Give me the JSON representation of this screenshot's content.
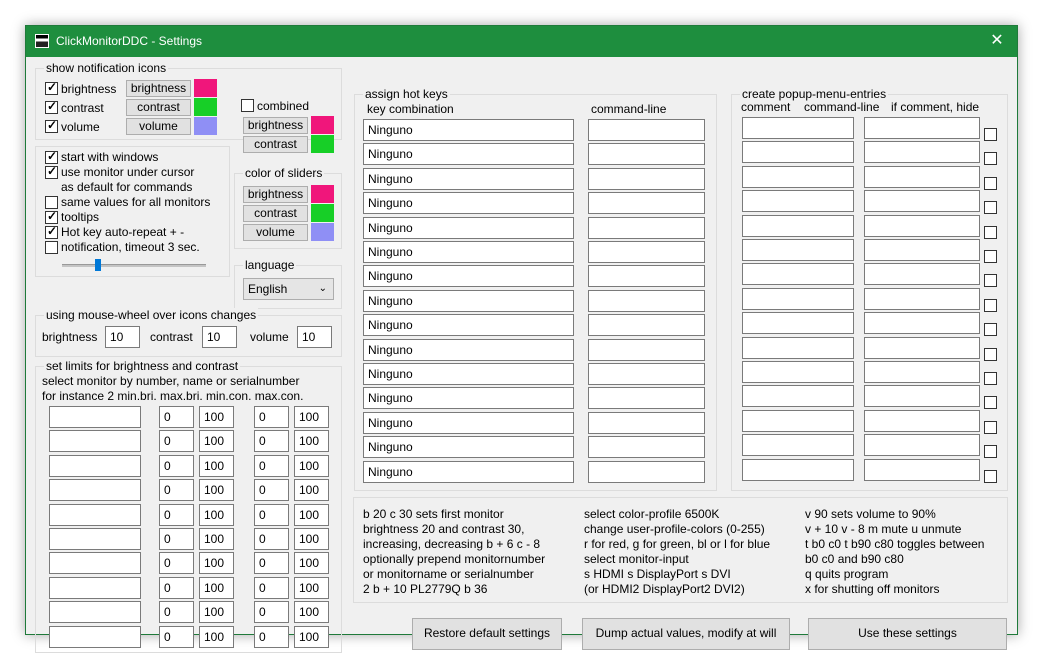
{
  "window": {
    "title": "ClickMonitorDDC - Settings",
    "close": "✕"
  },
  "notification": {
    "title": "show notification icons",
    "items": [
      {
        "label": "brightness",
        "checked": true,
        "button": "brightness",
        "color": "#f0167b"
      },
      {
        "label": "contrast",
        "checked": true,
        "button": "contrast",
        "color": "#17cf27"
      },
      {
        "label": "volume",
        "checked": true,
        "button": "volume",
        "color": "#8f8ff5"
      }
    ],
    "combined": {
      "label": "combined",
      "checked": false,
      "buttons": [
        {
          "label": "brightness",
          "color": "#f0167b"
        },
        {
          "label": "contrast",
          "color": "#17cf27"
        }
      ]
    }
  },
  "options": [
    {
      "label": "start with windows",
      "checked": true
    },
    {
      "label": "use monitor under cursor",
      "label2": "as default for commands",
      "checked": true
    },
    {
      "label": "same values for all monitors",
      "checked": false
    },
    {
      "label": "tooltips",
      "checked": true
    },
    {
      "label": "Hot key auto-repeat  +  -",
      "checked": true
    },
    {
      "label": "notification, timeout 3 sec.",
      "checked": false
    }
  ],
  "slider": {
    "value_fraction": 0.25
  },
  "sliders_color": {
    "title": "color of sliders",
    "items": [
      {
        "label": "brightness",
        "color": "#f0167b"
      },
      {
        "label": "contrast",
        "color": "#17cf27"
      },
      {
        "label": "volume",
        "color": "#8f8ff5"
      }
    ]
  },
  "language": {
    "title": "language",
    "value": "English"
  },
  "wheel": {
    "title": "using mouse-wheel over icons changes",
    "items": [
      {
        "label": "brightness",
        "value": "10"
      },
      {
        "label": "contrast",
        "value": "10"
      },
      {
        "label": "volume",
        "value": "10"
      }
    ]
  },
  "limits": {
    "title": "set limits for brightness and contrast",
    "line1": "select monitor by number, name or serialnumber",
    "line2": "for instance  2  min.bri. max.bri.  min.con. max.con.",
    "rows": [
      [
        "",
        "0",
        "100",
        "0",
        "100"
      ],
      [
        "",
        "0",
        "100",
        "0",
        "100"
      ],
      [
        "",
        "0",
        "100",
        "0",
        "100"
      ],
      [
        "",
        "0",
        "100",
        "0",
        "100"
      ],
      [
        "",
        "0",
        "100",
        "0",
        "100"
      ],
      [
        "",
        "0",
        "100",
        "0",
        "100"
      ],
      [
        "",
        "0",
        "100",
        "0",
        "100"
      ],
      [
        "",
        "0",
        "100",
        "0",
        "100"
      ],
      [
        "",
        "0",
        "100",
        "0",
        "100"
      ],
      [
        "",
        "0",
        "100",
        "0",
        "100"
      ]
    ]
  },
  "hotkeys": {
    "title": "assign hot keys",
    "col1": "key combination",
    "col2": "command-line",
    "rows": [
      {
        "key": "Ninguno",
        "cmd": ""
      },
      {
        "key": "Ninguno",
        "cmd": ""
      },
      {
        "key": "Ninguno",
        "cmd": ""
      },
      {
        "key": "Ninguno",
        "cmd": ""
      },
      {
        "key": "Ninguno",
        "cmd": ""
      },
      {
        "key": "Ninguno",
        "cmd": ""
      },
      {
        "key": "Ninguno",
        "cmd": ""
      },
      {
        "key": "Ninguno",
        "cmd": ""
      },
      {
        "key": "Ninguno",
        "cmd": ""
      },
      {
        "key": "Ninguno",
        "cmd": ""
      },
      {
        "key": "Ninguno",
        "cmd": ""
      },
      {
        "key": "Ninguno",
        "cmd": ""
      },
      {
        "key": "Ninguno",
        "cmd": ""
      },
      {
        "key": "Ninguno",
        "cmd": ""
      },
      {
        "key": "Ninguno",
        "cmd": ""
      }
    ]
  },
  "popup": {
    "title": "create popup-menu-entries",
    "col1": "comment",
    "col2": "command-line",
    "col3": "if comment, hide",
    "rows": [
      {
        "comment": "",
        "cmd": "",
        "hide": false
      },
      {
        "comment": "",
        "cmd": "",
        "hide": false
      },
      {
        "comment": "",
        "cmd": "",
        "hide": false
      },
      {
        "comment": "",
        "cmd": "",
        "hide": false
      },
      {
        "comment": "",
        "cmd": "",
        "hide": false
      },
      {
        "comment": "",
        "cmd": "",
        "hide": false
      },
      {
        "comment": "",
        "cmd": "",
        "hide": false
      },
      {
        "comment": "",
        "cmd": "",
        "hide": false
      },
      {
        "comment": "",
        "cmd": "",
        "hide": false
      },
      {
        "comment": "",
        "cmd": "",
        "hide": false
      },
      {
        "comment": "",
        "cmd": "",
        "hide": false
      },
      {
        "comment": "",
        "cmd": "",
        "hide": false
      },
      {
        "comment": "",
        "cmd": "",
        "hide": false
      },
      {
        "comment": "",
        "cmd": "",
        "hide": false
      },
      {
        "comment": "",
        "cmd": "",
        "hide": false
      }
    ]
  },
  "help": {
    "col1": [
      "b 20  c 30  sets first monitor",
      "brightness 20 and contrast 30,",
      "increasing, decreasing  b + 6   c - 8",
      "optionally prepend monitornumber",
      "or monitorname or serialnumber",
      "2  b + 10          PL2779Q   b 36"
    ],
    "col2": [
      "select color-profile  6500K",
      "change user-profile-colors (0-255)",
      "r for red, g for green, bl or l for blue",
      "select monitor-input",
      "s  HDMI    s  DisplayPort    s  DVI",
      "(or HDMI2  DisplayPort2  DVI2)"
    ],
    "col3": [
      "v 90 sets volume to 90%",
      "v + 10   v  - 8   m mute  u unmute",
      "t b0 c0 t b90 c80 toggles between",
      "b0 c0 and b90 c80",
      "q  quits program",
      "x for shutting off monitors"
    ]
  },
  "buttons": {
    "restore": "Restore default settings",
    "dump": "Dump actual values, modify at will",
    "use": "Use these settings"
  }
}
